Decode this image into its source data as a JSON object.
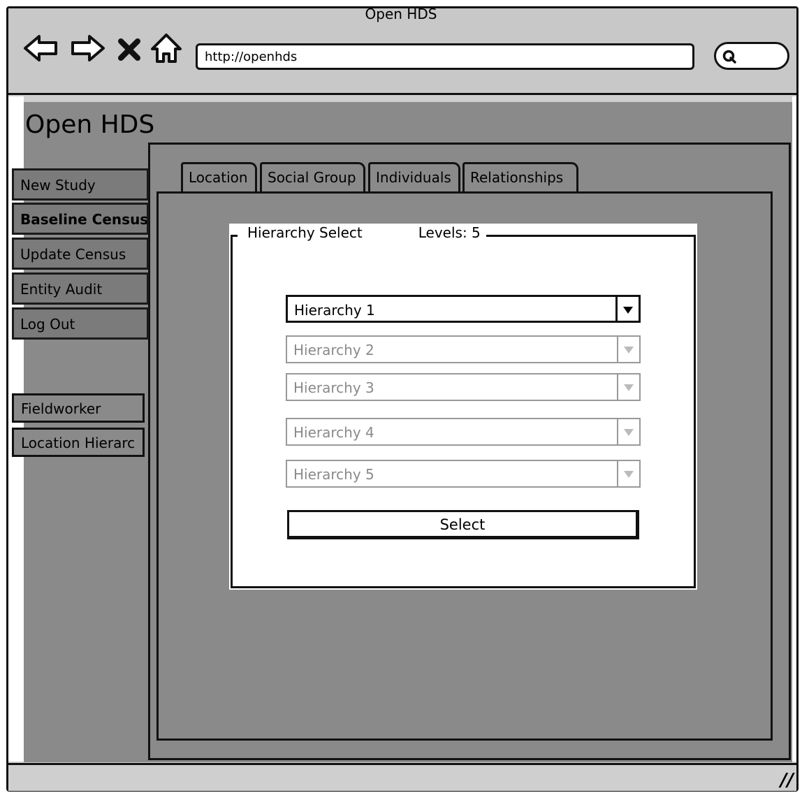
{
  "browser": {
    "title": "Open HDS",
    "url": "http://openhds",
    "nav_icons": [
      "back-arrow-icon",
      "forward-arrow-icon",
      "close-x-icon",
      "home-icon"
    ],
    "search_icon": "search-icon"
  },
  "app": {
    "title": "Open HDS"
  },
  "sidebar": {
    "items": [
      {
        "label": "New Study"
      },
      {
        "label": "Baseline Census"
      },
      {
        "label": "Update Census"
      },
      {
        "label": "Entity Audit"
      },
      {
        "label": "Log Out"
      }
    ],
    "secondary": [
      {
        "label": "Fieldworker"
      },
      {
        "label": "Location Hierarc"
      }
    ]
  },
  "tabs": [
    {
      "label": "Location"
    },
    {
      "label": "Social Group"
    },
    {
      "label": "Individuals"
    },
    {
      "label": "Relationships"
    }
  ],
  "hierarchy_select": {
    "legend": "Hierarchy Select",
    "levels": "Levels: 5",
    "combos": [
      {
        "value": "Hierarchy 1",
        "enabled": true
      },
      {
        "value": "Hierarchy 2",
        "enabled": false
      },
      {
        "value": "Hierarchy 3",
        "enabled": false
      },
      {
        "value": "Hierarchy 4",
        "enabled": false
      },
      {
        "value": "Hierarchy 5",
        "enabled": false
      }
    ],
    "select_label": "Select"
  },
  "statusbar": {
    "resize_glyph": "//"
  },
  "colors": {
    "content_bg": "#8a8a8a",
    "frame_bg": "#c8c8c8",
    "disabled_text": "#8a8a8a"
  }
}
